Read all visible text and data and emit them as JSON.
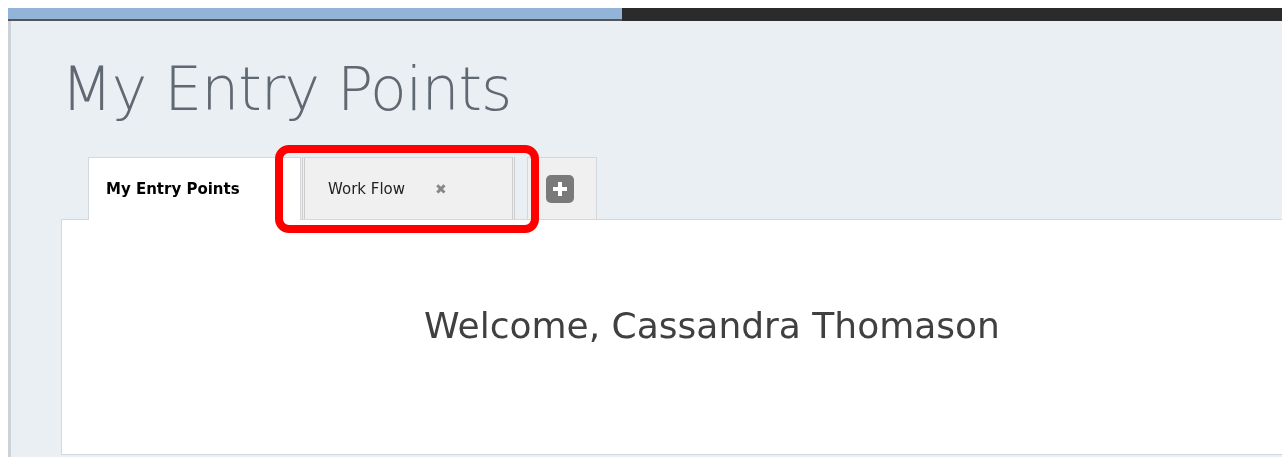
{
  "page": {
    "title": "My Entry Points"
  },
  "tabs": [
    {
      "label": "My Entry Points",
      "selected": true,
      "highlighted": false
    },
    {
      "label": "Work Flow",
      "selected": false,
      "close": "✖",
      "highlighted": true
    }
  ],
  "add_tab": {
    "kind": "add"
  },
  "content": {
    "welcome": "Welcome, Cassandra Thomason"
  }
}
